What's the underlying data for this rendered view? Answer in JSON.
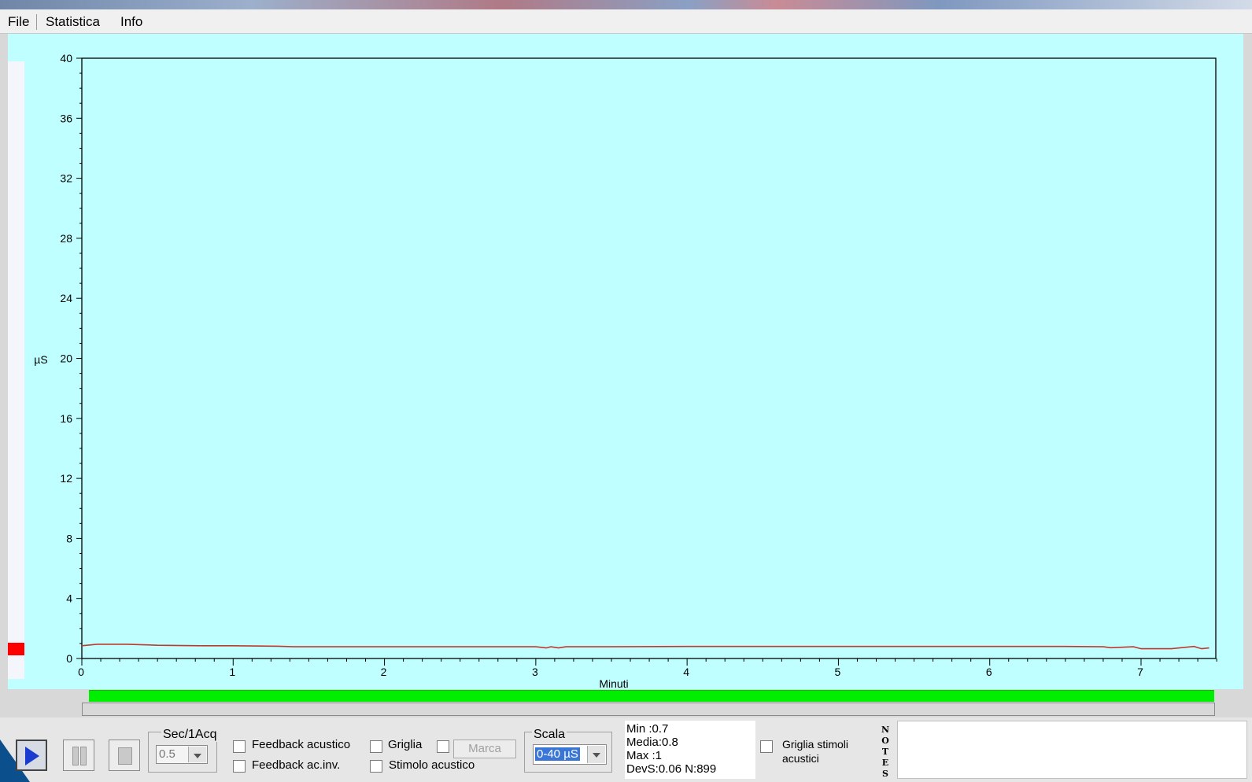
{
  "menu": {
    "items": [
      "File",
      "Statistica",
      "Info"
    ]
  },
  "chart_data": {
    "type": "line",
    "xlabel": "Minuti",
    "ylabel": "µS",
    "xlim": [
      0,
      7.5
    ],
    "ylim": [
      0,
      40
    ],
    "x_ticks": [
      0,
      1,
      2,
      3,
      4,
      5,
      6,
      7
    ],
    "y_ticks": [
      0,
      4,
      8,
      12,
      16,
      20,
      24,
      28,
      32,
      36,
      40
    ],
    "grid": false,
    "series": [
      {
        "color": "#c0392b",
        "x": [
          0,
          0.1,
          0.3,
          0.45,
          0.5,
          0.8,
          1.0,
          1.3,
          1.4,
          2.0,
          2.5,
          3.0,
          3.07,
          3.1,
          3.15,
          3.2,
          3.5,
          4.0,
          4.5,
          5.0,
          5.5,
          6.0,
          6.5,
          6.75,
          6.8,
          6.95,
          7.0,
          7.2,
          7.35,
          7.4,
          7.45
        ],
        "y": [
          0.85,
          0.95,
          0.95,
          0.9,
          0.88,
          0.85,
          0.85,
          0.82,
          0.78,
          0.78,
          0.78,
          0.78,
          0.7,
          0.78,
          0.7,
          0.78,
          0.78,
          0.8,
          0.8,
          0.8,
          0.8,
          0.8,
          0.8,
          0.78,
          0.72,
          0.78,
          0.65,
          0.65,
          0.8,
          0.65,
          0.7
        ]
      }
    ]
  },
  "controls": {
    "sec_acq": {
      "label": "Sec/1Acq",
      "value": "0.5"
    },
    "checkboxes": {
      "feedback_acustico": "Feedback acustico",
      "feedback_ac_inv": "Feedback ac.inv.",
      "griglia": "Griglia",
      "stimolo_acustico": "Stimolo acustico",
      "griglia_stimoli": "Griglia stimoli",
      "griglia_stimoli_2": "acustici"
    },
    "marca_label": "Marca",
    "scala": {
      "label": "Scala",
      "value": "0-40 µS"
    }
  },
  "stats": {
    "min": "Min   :0.7",
    "media": "Media:0.8",
    "max": "Max   :1",
    "devs": "DevS:0.06  N:899"
  },
  "notes_label": [
    "N",
    "O",
    "T",
    "E",
    "S"
  ],
  "colors": {
    "chart_bg": "#bfffff",
    "progress": "#00ee00",
    "marker": "#ff0000",
    "trace": "#c0392b"
  }
}
